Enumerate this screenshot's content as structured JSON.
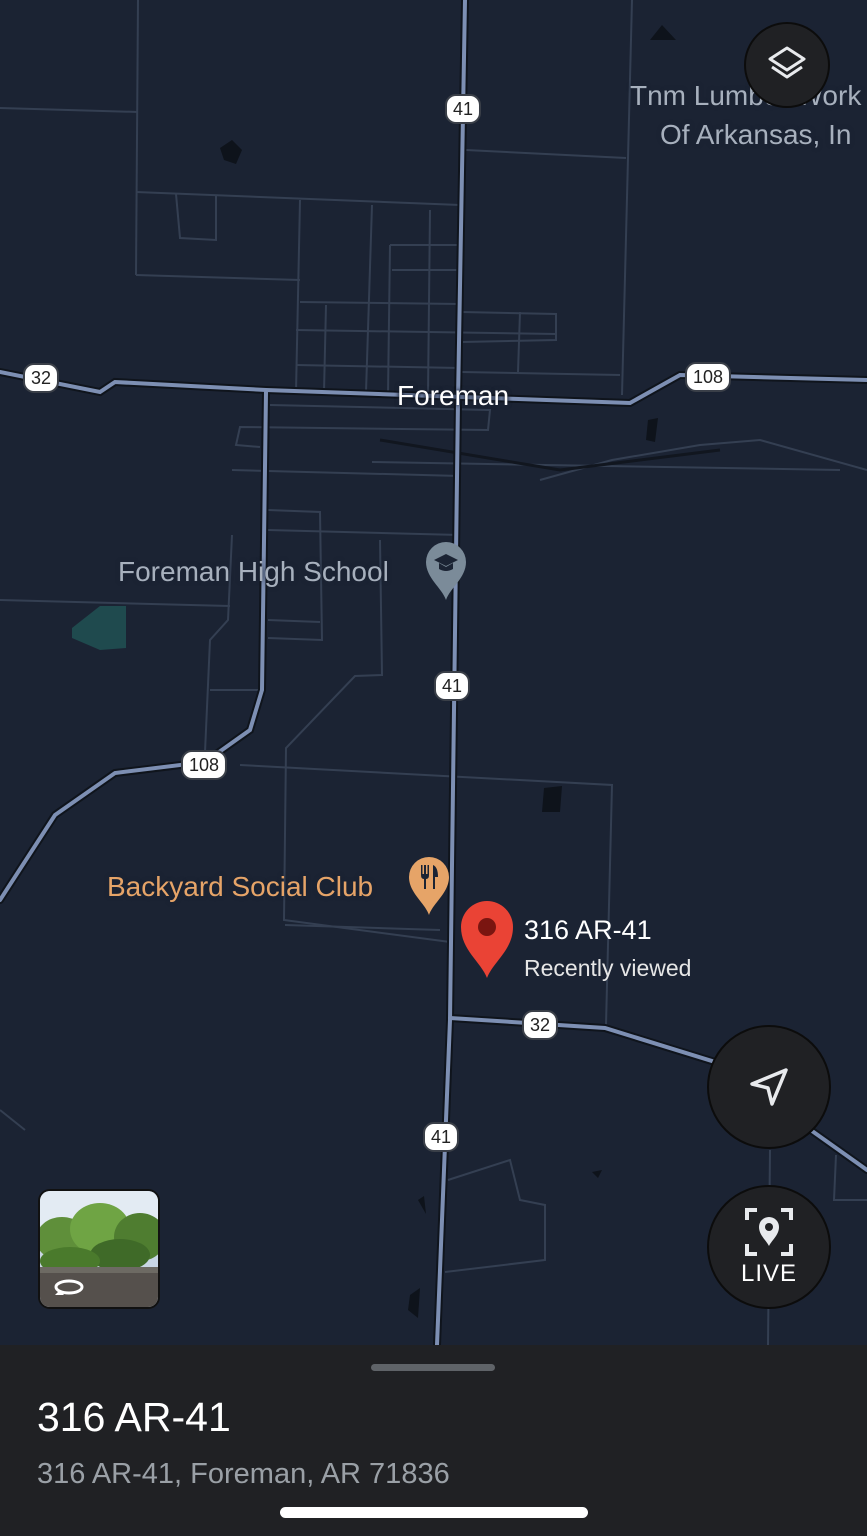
{
  "map": {
    "town_label": "Foreman",
    "poi_top_right": {
      "line1": "Tnm Lumber Work",
      "line2": "Of Arkansas, In"
    },
    "school_label": "Foreman High School",
    "school_icon": "graduation-cap-icon",
    "restaurant_label": "Backyard Social Club",
    "restaurant_icon": "fork-knife-icon",
    "pin": {
      "title": "316 AR-41",
      "subtitle": "Recently viewed",
      "color": "#ea4335"
    },
    "shields": {
      "h41_top": "41",
      "h41_mid": "41",
      "h41_bot": "41",
      "h32_left": "32",
      "h108_right": "108",
      "h108_left": "108",
      "h32_bot": "32"
    },
    "road_color": "#7d8fb3",
    "colors": {
      "background": "#1b2333",
      "poi_orange": "#e6a468",
      "poi_gray": "#a7b0bd"
    }
  },
  "controls": {
    "layers_icon": "layers-icon",
    "navigate_icon": "navigation-arrow-icon",
    "live_label": "LIVE",
    "live_icon": "live-view-icon",
    "street_view_icon": "rotate-360-icon"
  },
  "sheet": {
    "title": "316 AR-41",
    "address": "316 AR-41, Foreman, AR 71836"
  }
}
